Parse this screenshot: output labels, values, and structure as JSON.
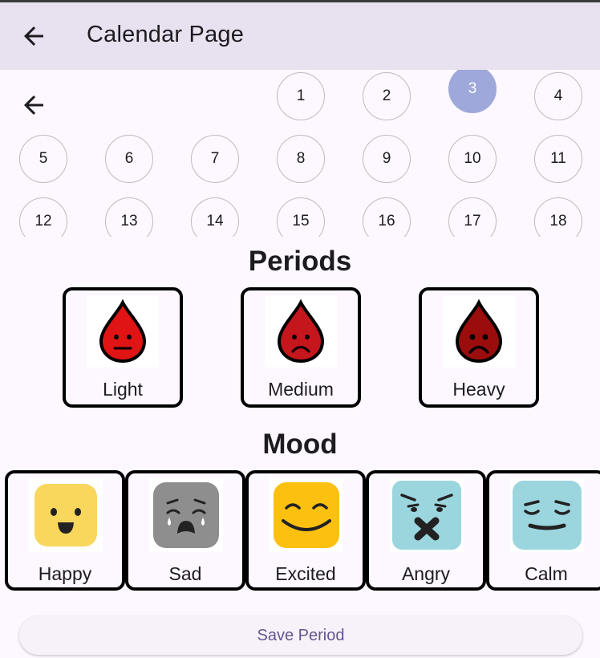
{
  "app_bar": {
    "title": "Calendar Page"
  },
  "calendar": {
    "selected_day": "3",
    "rows": [
      [
        "1",
        "2",
        "3",
        "4"
      ],
      [
        "5",
        "6",
        "7",
        "8",
        "9",
        "10",
        "11"
      ],
      [
        "12",
        "13",
        "14",
        "15",
        "16",
        "17",
        "18"
      ]
    ]
  },
  "periods": {
    "title": "Periods",
    "options": [
      {
        "label": "Light",
        "icon": "drop-neutral-face-icon",
        "color": "#e01414"
      },
      {
        "label": "Medium",
        "icon": "drop-sad-face-icon",
        "color": "#c4161c"
      },
      {
        "label": "Heavy",
        "icon": "drop-sad-face-icon",
        "color": "#9b0d0d"
      }
    ]
  },
  "mood": {
    "title": "Mood",
    "options": [
      {
        "label": "Happy",
        "icon": "happy-face-icon",
        "color": "#f9d65c"
      },
      {
        "label": "Sad",
        "icon": "crying-face-icon",
        "color": "#8e8e8e"
      },
      {
        "label": "Excited",
        "icon": "grinning-face-icon",
        "color": "#fcc010"
      },
      {
        "label": "Angry",
        "icon": "angry-face-icon",
        "color": "#9bd5de"
      },
      {
        "label": "Calm",
        "icon": "calm-face-icon",
        "color": "#9bd5de"
      }
    ]
  },
  "save_button": {
    "label": "Save Period"
  }
}
